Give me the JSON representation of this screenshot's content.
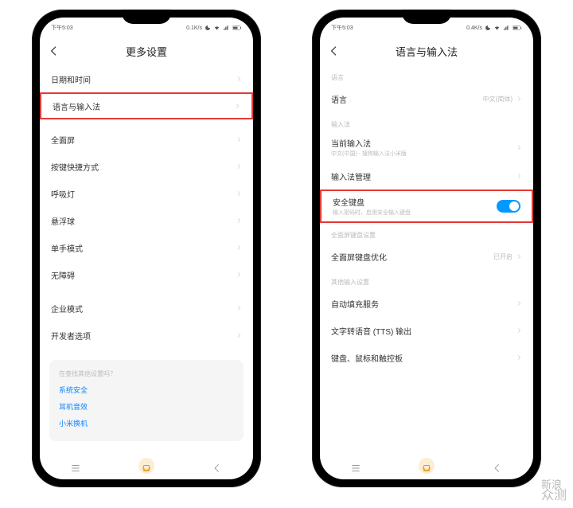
{
  "colors": {
    "highlight": "#e53935",
    "accent": "#09f",
    "link": "#0a84ff"
  },
  "watermark": {
    "line1": "新浪",
    "line2": "众测"
  },
  "phone_left": {
    "status": {
      "time": "下午5:03",
      "net": "0.1K/s"
    },
    "title": "更多设置",
    "rows": [
      {
        "label": "日期和时间"
      },
      {
        "label": "语言与输入法",
        "highlight": true
      },
      {
        "label": "全面屏"
      },
      {
        "label": "按键快捷方式"
      },
      {
        "label": "呼吸灯"
      },
      {
        "label": "悬浮球"
      },
      {
        "label": "单手模式"
      },
      {
        "label": "无障碍"
      },
      {
        "label": "企业模式"
      },
      {
        "label": "开发者选项"
      }
    ],
    "footer": {
      "question": "在查找其他设置吗？",
      "links": [
        "系统安全",
        "耳机音效",
        "小米换机"
      ]
    }
  },
  "phone_right": {
    "status": {
      "time": "下午5:03",
      "net": "0.4K/s"
    },
    "title": "语言与输入法",
    "sections": [
      {
        "header": "语言",
        "rows": [
          {
            "label": "语言",
            "value": "中文(简体)"
          }
        ]
      },
      {
        "header": "输入法",
        "rows": [
          {
            "label": "当前输入法",
            "sub": "中文(中国) - 搜狗输入法小米版"
          },
          {
            "label": "输入法管理"
          },
          {
            "label": "安全键盘",
            "sub": "输入密码时，启用安全输入键盘",
            "toggle": true,
            "highlight": true
          }
        ]
      },
      {
        "header": "全面屏键盘设置",
        "rows": [
          {
            "label": "全面屏键盘优化",
            "value": "已开启"
          }
        ]
      },
      {
        "header": "其他输入设置",
        "rows": [
          {
            "label": "自动填充服务"
          },
          {
            "label": "文字转语音 (TTS) 输出"
          },
          {
            "label": "键盘、鼠标和触控板"
          }
        ]
      }
    ]
  }
}
